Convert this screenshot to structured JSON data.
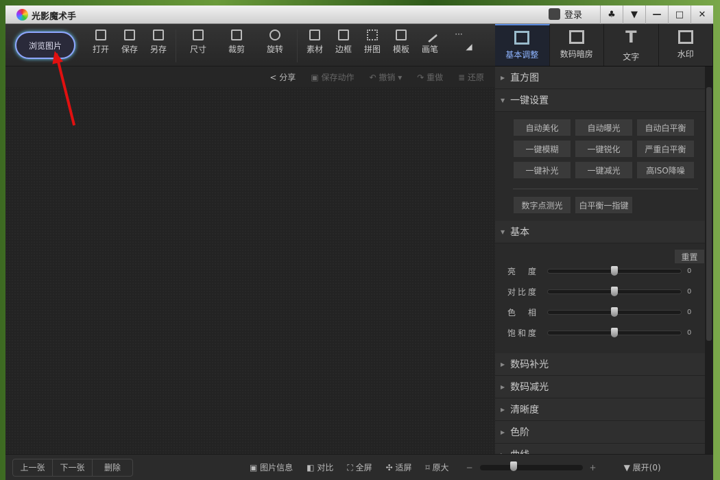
{
  "app": {
    "title": "光影魔术手",
    "login": "登录",
    "window_buttons": [
      "skin",
      "menu",
      "minimize",
      "maximize",
      "close"
    ]
  },
  "toolbar": {
    "browse": "浏览图片",
    "tools": [
      {
        "label": "打开"
      },
      {
        "label": "保存"
      },
      {
        "label": "另存"
      },
      {
        "label": "尺寸",
        "dropdown": true
      },
      {
        "label": "裁剪",
        "dropdown": true
      },
      {
        "label": "旋转",
        "dropdown": true
      },
      {
        "label": "素材"
      },
      {
        "label": "边框"
      },
      {
        "label": "拼图"
      },
      {
        "label": "模板"
      },
      {
        "label": "画笔"
      },
      {
        "label": "···"
      }
    ]
  },
  "subbar": {
    "share": "分享",
    "save_action": "保存动作",
    "undo": "撤销",
    "redo": "重做",
    "restore": "还原"
  },
  "right_tabs": [
    {
      "label": "基本调整",
      "active": true
    },
    {
      "label": "数码暗房"
    },
    {
      "label": "文字"
    },
    {
      "label": "水印"
    }
  ],
  "panel": {
    "histogram": "直方图",
    "one_click": {
      "title": "一键设置",
      "buttons": [
        "自动美化",
        "自动曝光",
        "自动白平衡",
        "一键模糊",
        "一键锐化",
        "严重白平衡",
        "一键补光",
        "一键减光",
        "高ISO降噪"
      ],
      "extra": [
        "数字点测光",
        "白平衡一指键"
      ]
    },
    "basic": {
      "title": "基本",
      "reset": "重置",
      "sliders": [
        {
          "label": "亮　度",
          "value": "0"
        },
        {
          "label": "对比度",
          "value": "0"
        },
        {
          "label": "色　相",
          "value": "0"
        },
        {
          "label": "饱和度",
          "value": "0"
        }
      ]
    },
    "sections": [
      "数码补光",
      "数码减光",
      "清晰度",
      "色阶",
      "曲线"
    ]
  },
  "bottom": {
    "prev": "上一张",
    "next": "下一张",
    "delete": "删除",
    "info": "图片信息",
    "compare": "对比",
    "fullscreen": "全屏",
    "fit": "适屏",
    "original": "原大",
    "minus": "−",
    "plus": "+",
    "expand": "展开(0)",
    "zoom_fraction": 0.33
  }
}
